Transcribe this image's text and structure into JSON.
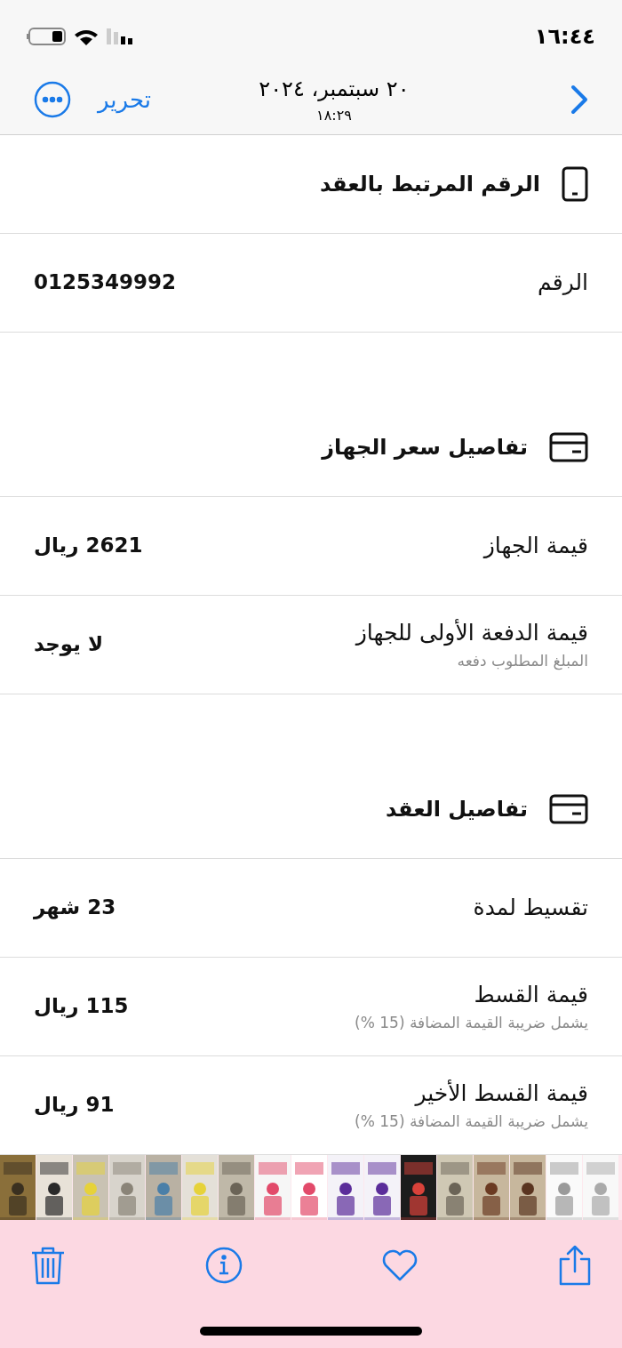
{
  "status_bar": {
    "time": "١٦:٤٤"
  },
  "nav": {
    "date": "٢٠ سبتمبر، ٢٠٢٤",
    "time": "١٨:٢٩",
    "edit": "تحرير"
  },
  "sections": [
    {
      "kind": "phone",
      "title": "الرقم المرتبط بالعقد",
      "rows": [
        {
          "label": "الرقم",
          "value": "0125349992"
        }
      ]
    },
    {
      "kind": "card",
      "title": "تفاصيل سعر الجهاز",
      "rows": [
        {
          "label": "قيمة الجهاز",
          "value": "2621 ريال"
        },
        {
          "label": "قيمة الدفعة الأولى للجهاز",
          "sub": "المبلغ المطلوب دفعه",
          "value": "لا يوجد"
        }
      ]
    },
    {
      "kind": "card",
      "title": "تفاصيل العقد",
      "rows": [
        {
          "label": "تقسيط لمدة",
          "value": "23 شهر"
        },
        {
          "label": "قيمة القسط",
          "sub": "يشمل ضريبة القيمة المضافة (15 %)",
          "value": "115 ريال"
        },
        {
          "label": "قيمة القسط الأخير",
          "sub": "يشمل ضريبة القيمة المضافة (15 %)",
          "value": "91 ريال"
        }
      ]
    }
  ]
}
